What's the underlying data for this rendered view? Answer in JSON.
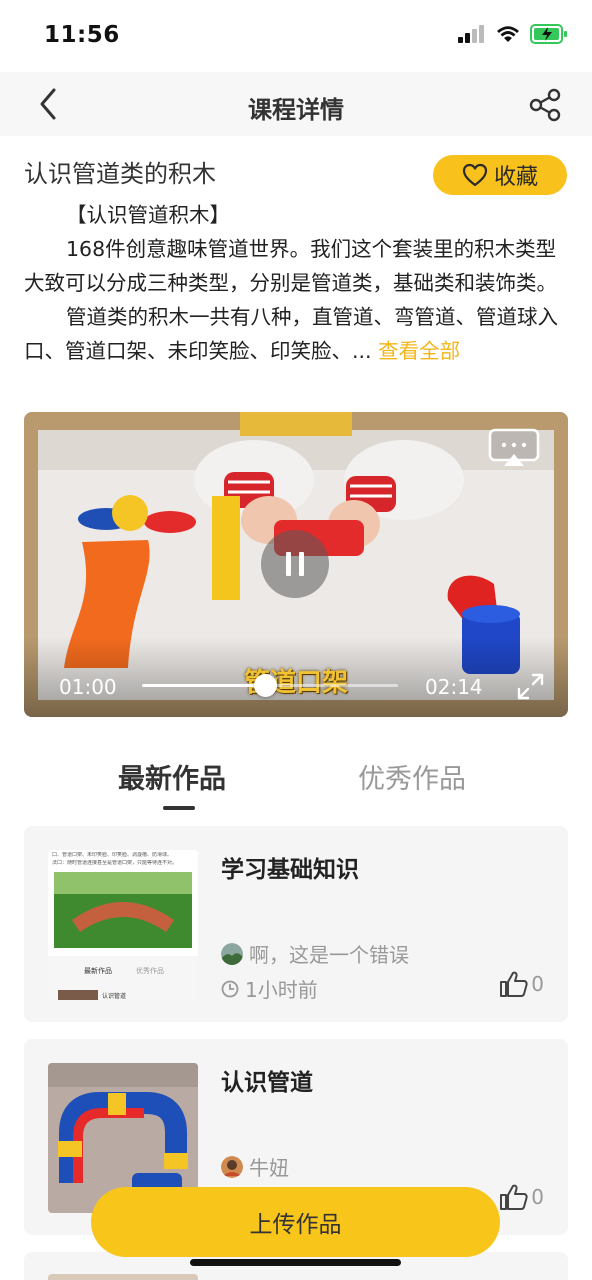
{
  "status": {
    "time": "11:56"
  },
  "nav": {
    "title": "课程详情"
  },
  "course": {
    "title": "认识管道类的积木",
    "favorite_label": "收藏",
    "desc_heading": "【认识管道积木】",
    "desc_para1": "168件创意趣味管道世界。我们这个套装里的积木类型大致可以分成三种类型，分别是管道类，基础类和装饰类。",
    "desc_para2": "管道类的积木一共有八种，直管道、弯管道、管道球入口、管道口架、未印笑脸、印笑脸、... ",
    "see_all": "查看全部"
  },
  "video": {
    "caption": "管道口架",
    "current_time": "01:00",
    "duration": "02:14",
    "progress": 0.48
  },
  "tabs": [
    "最新作品",
    "优秀作品"
  ],
  "works": [
    {
      "title": "学习基础知识",
      "author": "啊，这是一个错误",
      "time": "1小时前",
      "likes": "0",
      "thumb_text": {
        "line1": "口、管道口架、未印笑脸、印笑脸、涡漩槽、防滑球。",
        "line2": "法口：随时管道连接甚至是管道口架，只能等待连不对。",
        "tab_new": "最新作品",
        "tab_best": "优秀作品",
        "item": "认识管道"
      }
    },
    {
      "title": "认识管道",
      "author": "牛妞",
      "likes": "0"
    }
  ],
  "upload_label": "上传作品",
  "colors": {
    "accent": "#f8c51a",
    "link": "#f2b61b"
  }
}
